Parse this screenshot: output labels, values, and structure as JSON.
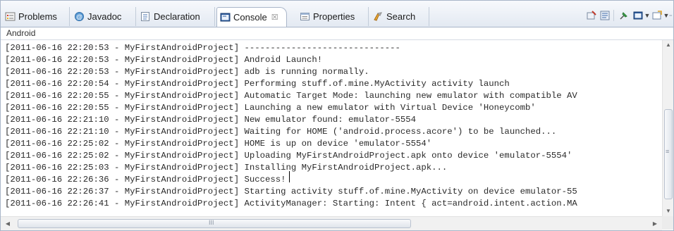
{
  "tabs": [
    {
      "label": "Problems",
      "icon": "problems-icon"
    },
    {
      "label": "Javadoc",
      "icon": "javadoc-icon"
    },
    {
      "label": "Declaration",
      "icon": "declaration-icon"
    },
    {
      "label": "Console",
      "icon": "console-icon",
      "active": true,
      "close_mark": "☒"
    },
    {
      "label": "Properties",
      "icon": "properties-icon"
    },
    {
      "label": "Search",
      "icon": "search-icon"
    }
  ],
  "view": {
    "title": "Android"
  },
  "console_lines": [
    {
      "prefix": "[2011-06-16 22:20:53 - MyFirstAndroidProject]",
      "message": "------------------------------"
    },
    {
      "prefix": "[2011-06-16 22:20:53 - MyFirstAndroidProject]",
      "message": "Android Launch!"
    },
    {
      "prefix": "[2011-06-16 22:20:53 - MyFirstAndroidProject]",
      "message": "adb is running normally."
    },
    {
      "prefix": "[2011-06-16 22:20:54 - MyFirstAndroidProject]",
      "message": "Performing stuff.of.mine.MyActivity activity launch"
    },
    {
      "prefix": "[2011-06-16 22:20:55 - MyFirstAndroidProject]",
      "message": "Automatic Target Mode: launching new emulator with compatible AV"
    },
    {
      "prefix": "[2011-06-16 22:20:55 - MyFirstAndroidProject]",
      "message": "Launching a new emulator with Virtual Device 'Honeycomb'"
    },
    {
      "prefix": "[2011-06-16 22:21:10 - MyFirstAndroidProject]",
      "message": "New emulator found: emulator-5554"
    },
    {
      "prefix": "[2011-06-16 22:21:10 - MyFirstAndroidProject]",
      "message": "Waiting for HOME ('android.process.acore') to be launched..."
    },
    {
      "prefix": "[2011-06-16 22:25:02 - MyFirstAndroidProject]",
      "message": "HOME is up on device 'emulator-5554'"
    },
    {
      "prefix": "[2011-06-16 22:25:02 - MyFirstAndroidProject]",
      "message": "Uploading MyFirstAndroidProject.apk onto device 'emulator-5554'"
    },
    {
      "prefix": "[2011-06-16 22:25:03 - MyFirstAndroidProject]",
      "message": "Installing MyFirstAndroidProject.apk..."
    },
    {
      "prefix": "[2011-06-16 22:26:36 - MyFirstAndroidProject]",
      "message": "Success!"
    },
    {
      "prefix": "[2011-06-16 22:26:37 - MyFirstAndroidProject]",
      "message": "Starting activity stuff.of.mine.MyActivity on device emulator-55"
    },
    {
      "prefix": "[2011-06-16 22:26:41 - MyFirstAndroidProject]",
      "message": "ActivityManager: Starting: Intent { act=android.intent.action.MA"
    }
  ],
  "scrollbar": {
    "h_grip": "III",
    "v_grip": "≡"
  },
  "toolbar_icons": [
    "clear-console-icon",
    "scroll-lock-icon",
    "pin-console-icon",
    "display-selected-console-icon",
    "open-console-icon",
    "minimize-icon",
    "maximize-icon"
  ]
}
